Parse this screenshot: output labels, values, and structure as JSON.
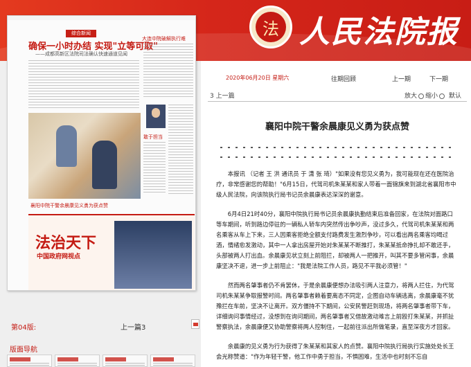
{
  "header": {
    "masthead": "人民法院报",
    "emblem_text": "法"
  },
  "thumbnail": {
    "column_tag": "综合新闻",
    "headline": "确保一小时办结 实现\"立等可取\"",
    "subheadline": "——成都高新区法院司法确认快速通道见闻",
    "side_headline": "大连中院破解执行难",
    "portrait_caption": "敢于担当",
    "photo_caption": "襄阳中院干警余晨康见义勇为获点赞",
    "ad_title": "法治天下",
    "ad_sub": "中国政府网视点"
  },
  "page_info": {
    "page_label": "第04版:",
    "prev_page": "上一篇3",
    "nav_title": "版面导航"
  },
  "toolbar": {
    "date": "2020年06月20日 星期六",
    "past": "往期回顾",
    "prev_issue": "上一期",
    "next_issue": "下一期",
    "pager": "3 上一篇",
    "zoom_in": "放大",
    "zoom_out": "缩小",
    "zoom_reset": "默认"
  },
  "article": {
    "title": "襄阳中院干警余晨康见义勇为获点赞",
    "paragraphs": [
      "本报讯 （记者 王 洪 通讯员 于 潇 张 琦）\"如果没有您见义勇为，我可能现在还在医院治疗，非常感谢您的帮助！\"6月15日，代驾司机朱某某和家人带着一面锦旗来到湖北省襄阳市中级人民法院，向该院执行局书记员余晨康表达深深的谢意。",
      "6月4日21时40分，襄阳中院执行局书记员余晨康执勤结束后准备回家，在法院对面路口等车期间，听到路边停驻的一辆私人轿车内突然传出争吵声，没过多久，代驾司机朱某某和两名乘客从车上下来，三人因乘客拒绝全额支付路费发生激烈争吵，可以看出两名乘客均喝过酒，情绪愈发激动，其中一人拿出房屋开始对朱某某不断推打，朱某某抵命挣扎却不敢还手，头部被两人打出血。余晨康见状立刻上前阻拦，却被两人一把推开，叫其不要多管闲事，余晨康坚决不退，进一步上前阻止：\"我是法院工作人员，路见不平我必须管！\"",
      "然而两名肇事者仍不肯罢休，于是余晨康便想办法吸引两人注意力，将两人拦住，为代驾司机朱某某争取报警时间。两名肇事者赖着要离态不同定，企图自动车辆逃离，余晨康毫不犹豫拦在车前，坚决不让离开。双方僵持不下期间，公安民警赶到现场，将两名肇事者带下车，详细询问事情经过，没想到在询问期间，两名肇事者又借故激动难言上前殴打朱某某，并抓扯警察执法，余晨康便又协助警察将两人控制住，一起前往派出所做笔录，直至深夜方才回家。",
      "余晨康的见义勇为行为获得了朱某某和其家人的点赞。襄阳中院执行局执行实施处处长王会光称赞道：\"作为年轻干警，他工作中勇于担当，不惧困难，生活中也时刻不忘自"
    ]
  },
  "colors": {
    "brand_red": "#c41a12",
    "banner_red": "#d5261a",
    "panel_gray": "#efefef"
  }
}
